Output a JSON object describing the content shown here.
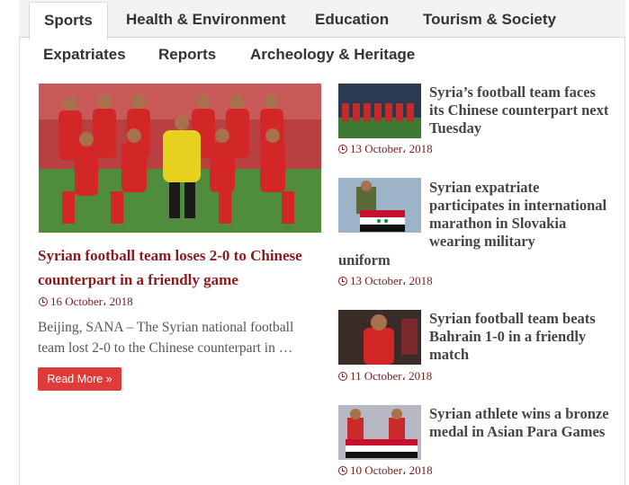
{
  "tabs": {
    "sports": "Sports",
    "health": "Health & Environment",
    "education": "Education",
    "tourism": "Tourism & Society",
    "expatriates": "Expatriates",
    "reports": "Reports",
    "archeology": "Archeology & Heritage"
  },
  "featured": {
    "title": "Syrian football team loses 2-0 to Chinese counterpart in a friendly game",
    "date": "16 October، 2018",
    "excerpt": "Beijing, SANA – The Syrian national football team lost 2-0 to the Chinese counterpart in …",
    "read_more": "Read More »"
  },
  "side_items": [
    {
      "title_a": "Syria’s football team faces its Chinese counterpart next Tuesday",
      "date": "13 October، 2018"
    },
    {
      "title_a": "Syrian expatriate participates in international marathon in Slovakia wearing military",
      "title_b": "uniform",
      "date": "13 October، 2018"
    },
    {
      "title_a": "Syrian football team beats Bahrain 1-0 in a friendly match",
      "date": "11 October، 2018"
    },
    {
      "title_a": "Syrian athlete wins a bronze medal in Asian Para Games",
      "date": "10 October، 2018"
    }
  ],
  "colors": {
    "title_red": "#8b1a1a",
    "button_red": "#e03b3b",
    "tab_bar": "#f2f2f2"
  }
}
